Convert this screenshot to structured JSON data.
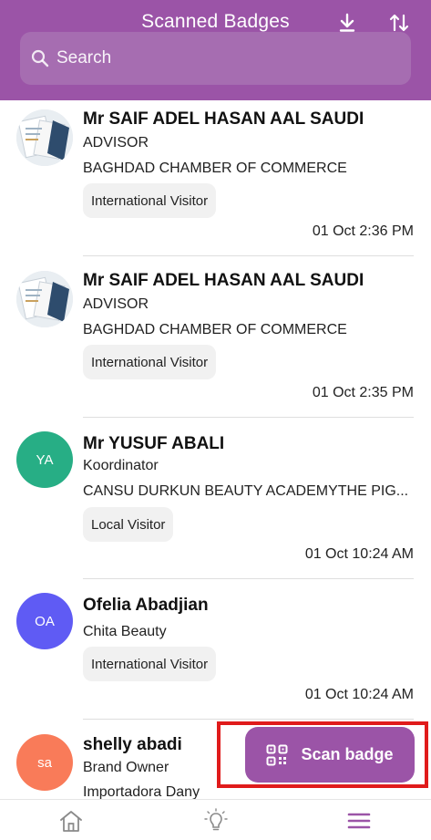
{
  "header": {
    "title": "Scanned Badges",
    "download_icon": "download-icon",
    "sort_icon": "sort-icon",
    "search_placeholder": "Search",
    "background": "#9b54a7"
  },
  "badges": [
    {
      "avatar_type": "photo",
      "initials": "",
      "avatar_color": "",
      "name": "Mr SAIF ADEL HASAN AAL SAUDI",
      "title": "ADVISOR",
      "company": "BAGHDAD CHAMBER OF COMMERCE",
      "tag": "International Visitor",
      "time": "01 Oct 2:36 PM"
    },
    {
      "avatar_type": "photo",
      "initials": "",
      "avatar_color": "",
      "name": "Mr SAIF ADEL HASAN AAL SAUDI",
      "title": "ADVISOR",
      "company": "BAGHDAD CHAMBER OF COMMERCE",
      "tag": "International Visitor",
      "time": "01 Oct 2:35 PM"
    },
    {
      "avatar_type": "initials",
      "initials": "YA",
      "avatar_color": "#27ae85",
      "name": "Mr YUSUF ABALI",
      "title": "Koordinator",
      "company": "CANSU DURKUN BEAUTY ACADEMYTHE PIG...",
      "tag": "Local Visitor",
      "time": "01 Oct 10:24 AM"
    },
    {
      "avatar_type": "initials",
      "initials": "OA",
      "avatar_color": "#5f5bf4",
      "name": "Ofelia Abadjian",
      "title": "Chita Beauty",
      "company": "",
      "tag": "International Visitor",
      "time": "01 Oct 10:24 AM"
    },
    {
      "avatar_type": "initials",
      "initials": "sa",
      "avatar_color": "#f97b59",
      "name": "shelly abadi",
      "title": "Brand Owner",
      "company": "Importadora Dany",
      "tag": "",
      "time": ""
    }
  ],
  "scan_button": {
    "label": "Scan badge",
    "icon": "qr-code-icon"
  },
  "bottom_nav": {
    "items": [
      {
        "icon": "home-icon"
      },
      {
        "icon": "lightbulb-icon"
      },
      {
        "icon": "menu-icon",
        "active": true
      }
    ],
    "accent": "#9b54a7"
  }
}
